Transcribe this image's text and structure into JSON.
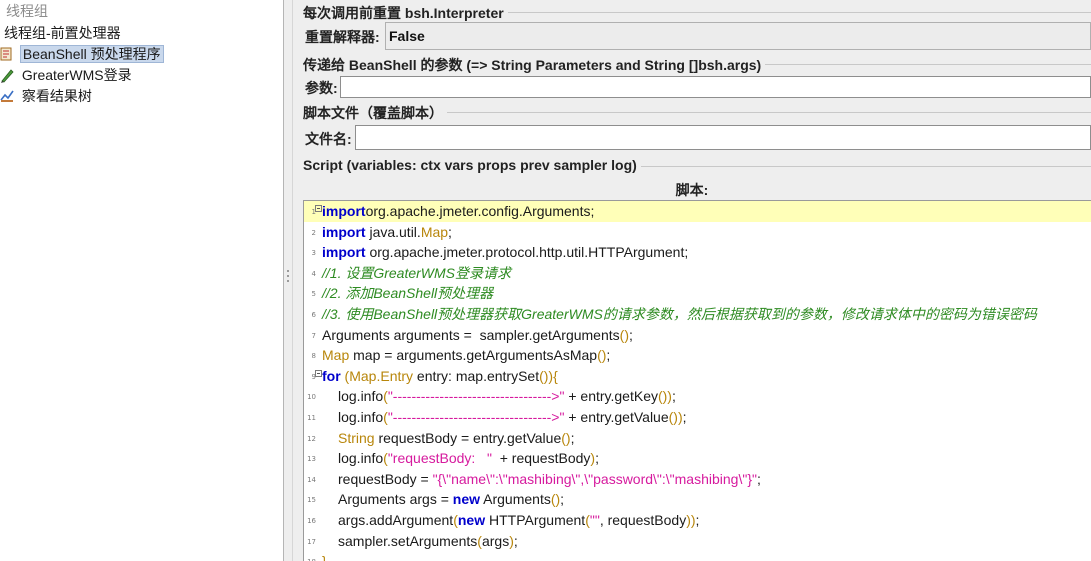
{
  "tree": {
    "items": [
      {
        "label": "线程组",
        "icon": "thread-group-icon"
      },
      {
        "label": "线程组-前置处理器",
        "icon": "none"
      },
      {
        "label": "BeanShell 预处理程序",
        "icon": "beanshell-icon"
      },
      {
        "label": "GreaterWMS登录",
        "icon": "sampler-pencil-icon"
      },
      {
        "label": "察看结果树",
        "icon": "listener-icon"
      }
    ]
  },
  "reset": {
    "section_title": "每次调用前重置 bsh.Interpreter",
    "label": "重置解释器:",
    "value": "False"
  },
  "params": {
    "section_title": "传递给 BeanShell 的参数 (=> String Parameters and String []bsh.args)",
    "label": "参数:",
    "value": ""
  },
  "file": {
    "section_title": "脚本文件（覆盖脚本）",
    "label": "文件名:",
    "value": ""
  },
  "script": {
    "section_title": "Script (variables: ctx vars props prev sampler log)",
    "header": "脚本:"
  },
  "colors": {
    "keyword": "#0000cc",
    "type": "#b8860b",
    "comment": "#2e8b22",
    "string": "#d61a9e",
    "current_line": "#ffffb8",
    "selection": "#c9d8ec"
  },
  "code": {
    "lines": [
      {
        "n": "1",
        "fold": true,
        "indent": false,
        "current": true,
        "tokens": [
          [
            "kw",
            "import"
          ],
          [
            "",
            "org.apache.jmeter.config.Arguments;"
          ]
        ]
      },
      {
        "n": "2",
        "fold": false,
        "indent": false,
        "tokens": [
          [
            "kw",
            "import"
          ],
          [
            "",
            " java.util."
          ],
          [
            "type",
            "Map"
          ],
          [
            "",
            ";"
          ]
        ]
      },
      {
        "n": "3",
        "fold": false,
        "indent": false,
        "tokens": [
          [
            "kw",
            "import"
          ],
          [
            "",
            " org.apache.jmeter.protocol.http.util.HTTPArgument;"
          ]
        ]
      },
      {
        "n": "4",
        "fold": false,
        "indent": false,
        "tokens": [
          [
            "cm",
            "//1. 设置GreaterWMS登录请求"
          ]
        ]
      },
      {
        "n": "5",
        "fold": false,
        "indent": false,
        "tokens": [
          [
            "cm",
            "//2. 添加BeanShell预处理器"
          ]
        ]
      },
      {
        "n": "6",
        "fold": false,
        "indent": false,
        "tokens": [
          [
            "cm",
            "//3. 使用BeanShell预处理器获取GreaterWMS的请求参数，然后根据获取到的参数，修改请求体中的密码为错误密码"
          ]
        ]
      },
      {
        "n": "7",
        "fold": false,
        "indent": false,
        "tokens": [
          [
            "",
            "Arguments arguments =  sampler.getArguments"
          ],
          [
            "paren",
            "()"
          ],
          [
            "",
            ";"
          ]
        ]
      },
      {
        "n": "8",
        "fold": false,
        "indent": false,
        "tokens": [
          [
            "type",
            "Map"
          ],
          [
            "",
            " map = arguments.getArgumentsAsMap"
          ],
          [
            "paren",
            "()"
          ],
          [
            "",
            ";"
          ]
        ]
      },
      {
        "n": "9",
        "fold": true,
        "indent": false,
        "tokens": [
          [
            "kw",
            "for"
          ],
          [
            "paren",
            " ("
          ],
          [
            "type",
            "Map.Entry"
          ],
          [
            "",
            " entry: map.entrySet"
          ],
          [
            "paren",
            "()){"
          ]
        ]
      },
      {
        "n": "10",
        "fold": false,
        "indent": true,
        "tokens": [
          [
            "",
            "log.info"
          ],
          [
            "paren",
            "("
          ],
          [
            "str",
            "\"---------------------------------->\""
          ],
          [
            "",
            " + entry.getKey"
          ],
          [
            "paren",
            "())"
          ],
          [
            "",
            ";"
          ]
        ]
      },
      {
        "n": "11",
        "fold": false,
        "indent": true,
        "tokens": [
          [
            "",
            "log.info"
          ],
          [
            "paren",
            "("
          ],
          [
            "str",
            "\"---------------------------------->\""
          ],
          [
            "",
            " + entry.getValue"
          ],
          [
            "paren",
            "())"
          ],
          [
            "",
            ";"
          ]
        ]
      },
      {
        "n": "12",
        "fold": false,
        "indent": true,
        "tokens": [
          [
            "type",
            "String"
          ],
          [
            "",
            " requestBody = entry.getValue"
          ],
          [
            "paren",
            "()"
          ],
          [
            "",
            ";"
          ]
        ]
      },
      {
        "n": "13",
        "fold": false,
        "indent": true,
        "tokens": [
          [
            "",
            "log.info"
          ],
          [
            "paren",
            "("
          ],
          [
            "str",
            "\"requestBody:   \""
          ],
          [
            "",
            "  + requestBody"
          ],
          [
            "paren",
            ")"
          ],
          [
            "",
            ";"
          ]
        ]
      },
      {
        "n": "14",
        "fold": false,
        "indent": true,
        "tokens": [
          [
            "",
            "requestBody = "
          ],
          [
            "str",
            "\"{\\\"name\\\":\\\"mashibing\\\",\\\"password\\\":\\\"mashibing\\\"}\""
          ],
          [
            "",
            ";"
          ]
        ]
      },
      {
        "n": "15",
        "fold": false,
        "indent": true,
        "tokens": [
          [
            "",
            "Arguments args = "
          ],
          [
            "kw",
            "new"
          ],
          [
            "",
            " Arguments"
          ],
          [
            "paren",
            "()"
          ],
          [
            "",
            ";"
          ]
        ]
      },
      {
        "n": "16",
        "fold": false,
        "indent": true,
        "tokens": [
          [
            "",
            "args.addArgument"
          ],
          [
            "paren",
            "("
          ],
          [
            "kw",
            "new"
          ],
          [
            "",
            " HTTPArgument"
          ],
          [
            "paren",
            "("
          ],
          [
            "str",
            "\"\""
          ],
          [
            "",
            ", requestBody"
          ],
          [
            "paren",
            "))"
          ],
          [
            "",
            ";"
          ]
        ]
      },
      {
        "n": "17",
        "fold": false,
        "indent": true,
        "tokens": [
          [
            "",
            "sampler.setArguments"
          ],
          [
            "paren",
            "("
          ],
          [
            "",
            "args"
          ],
          [
            "paren",
            ")"
          ],
          [
            "",
            ";"
          ]
        ]
      },
      {
        "n": "18",
        "fold": false,
        "indent": false,
        "tokens": [
          [
            "paren",
            "}"
          ]
        ]
      }
    ]
  }
}
